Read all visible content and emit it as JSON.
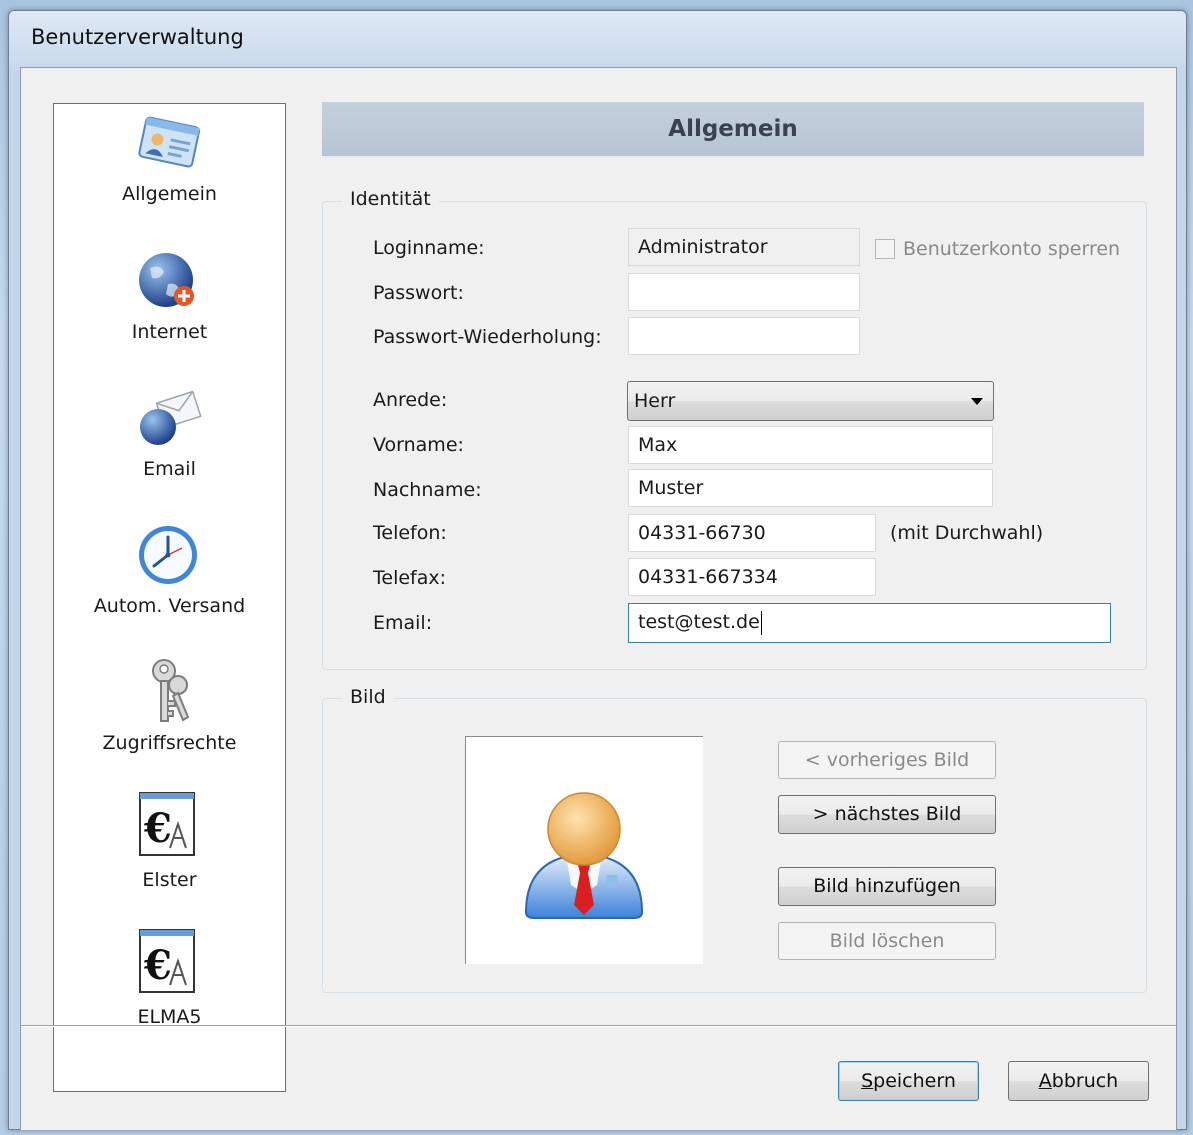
{
  "window": {
    "title": "Benutzerverwaltung"
  },
  "sidebar": {
    "items": [
      {
        "label": "Allgemein",
        "icon": "contact-card-icon"
      },
      {
        "label": "Internet",
        "icon": "globe-icon"
      },
      {
        "label": "Email",
        "icon": "email-globe-icon"
      },
      {
        "label": "Autom. Versand",
        "icon": "clock-icon"
      },
      {
        "label": "Zugriffsrechte",
        "icon": "keys-icon"
      },
      {
        "label": "Elster",
        "icon": "elster-document-icon"
      },
      {
        "label": "ELMA5",
        "icon": "elma5-document-icon"
      }
    ]
  },
  "header": {
    "title": "Allgemein"
  },
  "identity": {
    "group_title": "Identität",
    "login_label": "Loginname:",
    "login_value": "Administrator",
    "lock_label": "Benutzerkonto sperren",
    "password_label": "Passwort:",
    "password_value": "",
    "password_repeat_label": "Passwort-Wiederholung:",
    "password_repeat_value": "",
    "salutation_label": "Anrede:",
    "salutation_value": "Herr",
    "firstname_label": "Vorname:",
    "firstname_value": "Max",
    "lastname_label": "Nachname:",
    "lastname_value": "Muster",
    "phone_label": "Telefon:",
    "phone_value": "04331-66730",
    "phone_hint": "(mit Durchwahl)",
    "fax_label": "Telefax:",
    "fax_value": "04331-667334",
    "email_label": "Email:",
    "email_value": "test@test.de"
  },
  "picture": {
    "group_title": "Bild",
    "prev_label": "<  vorheriges Bild",
    "next_label": ">  nächstes Bild",
    "add_label": "Bild hinzufügen",
    "delete_label": "Bild löschen",
    "avatar_icon": "user-avatar-icon"
  },
  "footer": {
    "save_label_u": "S",
    "save_label_rest": "peichern",
    "cancel_label_u": "A",
    "cancel_label_rest": "bbruch"
  }
}
